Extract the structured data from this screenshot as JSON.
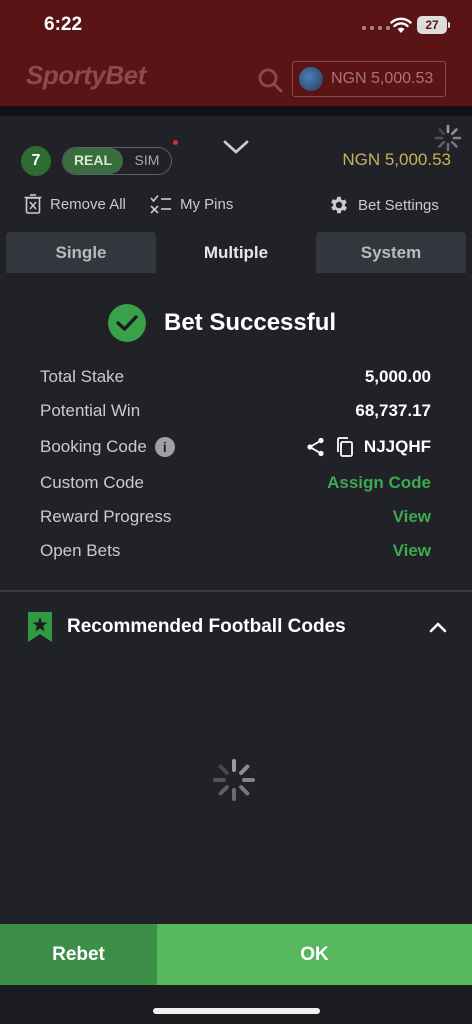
{
  "status": {
    "time": "6:22",
    "battery": "27"
  },
  "header": {
    "logo": "SportyBet",
    "balance": "NGN 5,000.53"
  },
  "betslip": {
    "count": "7",
    "mode_real": "REAL",
    "mode_sim": "SIM",
    "balance": "NGN 5,000.53",
    "tools": {
      "remove_all": "Remove All",
      "my_pins": "My Pins",
      "bet_settings": "Bet Settings"
    },
    "tabs": [
      {
        "label": "Single"
      },
      {
        "label": "Multiple"
      },
      {
        "label": "System"
      }
    ],
    "active_tab": "Multiple"
  },
  "result": {
    "title": "Bet Successful",
    "rows": {
      "total_stake": {
        "label": "Total Stake",
        "value": "5,000.00"
      },
      "potential_win": {
        "label": "Potential Win",
        "value": "68,737.17"
      },
      "booking_code": {
        "label": "Booking Code",
        "value": "NJJQHF"
      },
      "custom_code": {
        "label": "Custom Code",
        "value": "Assign Code"
      },
      "reward_progress": {
        "label": "Reward Progress",
        "value": "View"
      },
      "open_bets": {
        "label": "Open Bets",
        "value": "View"
      }
    }
  },
  "recommended": {
    "title": "Recommended Football Codes"
  },
  "buttons": {
    "rebet": "Rebet",
    "ok": "OK"
  },
  "colors": {
    "brand_red": "#5a1415",
    "accent_green": "#3daa4f",
    "ok_green": "#55b85e",
    "balance_gold": "#c8b15a"
  }
}
